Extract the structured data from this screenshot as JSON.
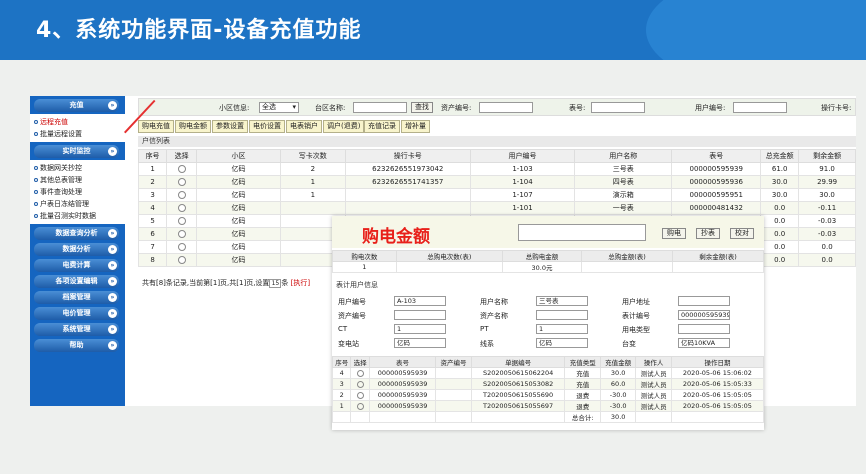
{
  "slide": {
    "title": "4、系统功能界面-设备充值功能"
  },
  "sidebar": {
    "sections": [
      {
        "head": "充值",
        "items": [
          {
            "label": "远程充值",
            "active": true
          },
          {
            "label": "批量远程设置",
            "active": false
          }
        ]
      },
      {
        "head": "实时监控",
        "items": [
          {
            "label": "数据网关抄控"
          },
          {
            "label": "其他总表管理"
          },
          {
            "label": "事件查询处理"
          },
          {
            "label": "户表日冻结管理"
          },
          {
            "label": "批量召测实时数据"
          }
        ]
      },
      {
        "head": "数据查询分析",
        "items": []
      },
      {
        "head": "数据分析",
        "items": []
      },
      {
        "head": "电费计算",
        "items": []
      },
      {
        "head": "各项设置编辑",
        "items": []
      },
      {
        "head": "档案管理",
        "items": []
      },
      {
        "head": "电价管理",
        "items": []
      },
      {
        "head": "系统管理",
        "items": []
      },
      {
        "head": "帮助",
        "items": []
      }
    ]
  },
  "filter": {
    "area_label": "小区信息:",
    "area_value": "全选",
    "station_label": "台区名称:",
    "search_button": "查找",
    "asset_label": "资产编号:",
    "meter_label": "表号:",
    "user_label": "用户编号:",
    "card_label": "操行卡号:"
  },
  "toolbar": [
    "购电充值",
    "购电金额",
    "参数设置",
    "电价设置",
    "电表销户",
    "调户(退费)",
    "充值记录",
    "增补量"
  ],
  "list_title": "户信列表",
  "grid": {
    "headers": [
      "序号",
      "选择",
      "小区",
      "写卡次数",
      "操行卡号",
      "用户编号",
      "用户名称",
      "表号",
      "总充金额",
      "剩余金额"
    ],
    "rows": [
      [
        "1",
        "",
        "亿码",
        "2",
        "6232626551973042",
        "1-103",
        "三号表",
        "000000595939",
        "61.0",
        "91.0"
      ],
      [
        "2",
        "",
        "亿码",
        "1",
        "6232626551741357",
        "1-104",
        "四号表",
        "000000595936",
        "30.0",
        "29.99"
      ],
      [
        "3",
        "",
        "亿码",
        "1",
        "",
        "1-107",
        "演示箱",
        "000000595951",
        "30.0",
        "30.0"
      ],
      [
        "4",
        "",
        "亿码",
        "",
        "",
        "1-101",
        "一号表",
        "000000481432",
        "0.0",
        "-0.11"
      ],
      [
        "5",
        "",
        "亿码",
        "",
        "",
        "",
        "",
        "",
        "0.0",
        "-0.03"
      ],
      [
        "6",
        "",
        "亿码",
        "",
        "",
        "",
        "",
        "",
        "0.0",
        "-0.03"
      ],
      [
        "7",
        "",
        "亿码",
        "",
        "",
        "",
        "",
        "",
        "0.0",
        "0.0"
      ],
      [
        "8",
        "",
        "亿码",
        "",
        "",
        "",
        "",
        "",
        "0.0",
        "0.0"
      ]
    ]
  },
  "pager": {
    "text_a": "共有[8]条记录,当前第[1]页,共[1]页,设置",
    "page_size": "15",
    "text_b": "条",
    "exec": "[执行]"
  },
  "overlay": {
    "title": "购电金额",
    "buttons": [
      "购电",
      "抄表",
      "校对"
    ],
    "summary_headers": [
      "购电次数",
      "总购电次数(表)",
      "总购电金额",
      "总购金额(表)",
      "剩余金额(表)"
    ],
    "summary_values": [
      "1",
      "",
      "30.0元",
      "",
      ""
    ],
    "section": "表计用户信息",
    "fields": [
      {
        "label": "用户编号",
        "value": "A-103"
      },
      {
        "label": "用户名称",
        "value": "三号表"
      },
      {
        "label": "用户地址",
        "value": ""
      },
      {
        "label": "资产编号",
        "value": ""
      },
      {
        "label": "资产名称",
        "value": ""
      },
      {
        "label": "表计编号",
        "value": "000000595939"
      },
      {
        "label": "CT",
        "value": "1"
      },
      {
        "label": "PT",
        "value": "1"
      },
      {
        "label": "用电类型",
        "value": ""
      },
      {
        "label": "变电站",
        "value": "亿码"
      },
      {
        "label": "线系",
        "value": "亿码"
      },
      {
        "label": "台变",
        "value": "亿码10KVA"
      }
    ],
    "rec_headers": [
      "序号",
      "选择",
      "表号",
      "资产编号",
      "单据编号",
      "充值类型",
      "充值金额",
      "操作人",
      "操作日期"
    ],
    "rec_rows": [
      [
        "4",
        "",
        "000000595939",
        "",
        "S2020050615062204",
        "充值",
        "30.0",
        "测试人员",
        "2020-05-06 15:06:02"
      ],
      [
        "3",
        "",
        "000000595939",
        "",
        "S2020050615053082",
        "充值",
        "60.0",
        "测试人员",
        "2020-05-06 15:05:33"
      ],
      [
        "2",
        "",
        "000000595939",
        "",
        "T2020050615055690",
        "退费",
        "-30.0",
        "测试人员",
        "2020-05-06 15:05:05"
      ],
      [
        "1",
        "",
        "000000595939",
        "",
        "T2020050615055697",
        "退费",
        "-30.0",
        "测试人员",
        "2020-05-06 15:05:05"
      ]
    ],
    "total_label": "总合计:",
    "total_value": "30.0"
  },
  "colors": {
    "banner": "#1d73c4",
    "sidebar": "#1565c0",
    "accent_red": "#e8201a"
  }
}
